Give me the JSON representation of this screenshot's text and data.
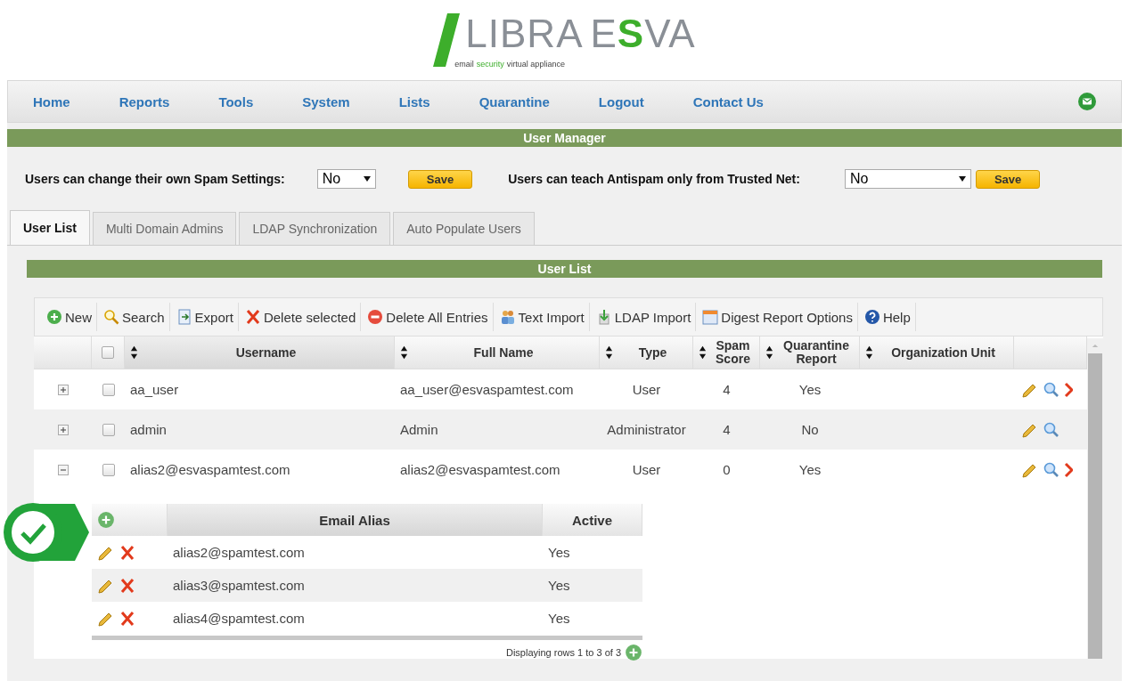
{
  "logo": {
    "words": [
      {
        "text": "LIBRA",
        "accent": false
      },
      {
        "text": "E",
        "accent": false
      },
      {
        "text": "S",
        "accent": true
      },
      {
        "text": "VA",
        "accent": false
      }
    ],
    "tagline": [
      {
        "text": "email",
        "accent": false
      },
      {
        "text": "security",
        "accent": true
      },
      {
        "text": "virtual appliance",
        "accent": false
      }
    ]
  },
  "nav": [
    "Home",
    "Reports",
    "Tools",
    "System",
    "Lists",
    "Quarantine",
    "Logout",
    "Contact Us"
  ],
  "section_title": "User Manager",
  "settings": [
    {
      "label": "Users can change their own Spam Settings:",
      "value": "No",
      "button": "Save",
      "wide": false
    },
    {
      "label": "Users can teach Antispam only from Trusted Net:",
      "value": "No",
      "button": "Save",
      "wide": true
    }
  ],
  "tabs": [
    {
      "label": "User List",
      "selected": true
    },
    {
      "label": "Multi Domain Admins",
      "selected": false
    },
    {
      "label": "LDAP Synchronization",
      "selected": false
    },
    {
      "label": "Auto Populate Users",
      "selected": false
    }
  ],
  "panel_title": "User List",
  "toolbar": [
    {
      "kind": "new",
      "label": "New"
    },
    {
      "kind": "search",
      "label": "Search"
    },
    {
      "kind": "export",
      "label": "Export"
    },
    {
      "kind": "delete",
      "label": "Delete selected"
    },
    {
      "kind": "delete-all",
      "label": "Delete All Entries"
    },
    {
      "kind": "import",
      "label": "Text Import"
    },
    {
      "kind": "ldap",
      "label": "LDAP Import"
    },
    {
      "kind": "digest",
      "label": "Digest Report Options"
    },
    {
      "kind": "help",
      "label": "Help"
    }
  ],
  "table": {
    "columns": [
      "Username",
      "Full Name",
      "Type",
      "Spam Score",
      "Quarantine Report",
      "Organization Unit"
    ],
    "header_checkbox": {
      "checked": false
    },
    "rows": [
      {
        "expanded": false,
        "checked": false,
        "username": "aa_user",
        "full_name": "aa_user@esvaspamtest.com",
        "type": "User",
        "spam_score": "4",
        "quarantine_report": "Yes",
        "deletable": true
      },
      {
        "expanded": false,
        "checked": false,
        "username": "admin",
        "full_name": "Admin",
        "type": "Administrator",
        "spam_score": "4",
        "quarantine_report": "No",
        "deletable": false
      },
      {
        "expanded": true,
        "checked": false,
        "username": "alias2@esvaspamtest.com",
        "full_name": "alias2@esvaspamtest.com",
        "type": "User",
        "spam_score": "0",
        "quarantine_report": "Yes",
        "deletable": true
      }
    ]
  },
  "alias_table": {
    "columns": [
      "Email Alias",
      "Active"
    ],
    "rows": [
      {
        "alias": "alias2@spamtest.com",
        "active": "Yes"
      },
      {
        "alias": "alias3@spamtest.com",
        "active": "Yes"
      },
      {
        "alias": "alias4@spamtest.com",
        "active": "Yes"
      }
    ],
    "footer": "Displaying rows 1 to 3 of 3"
  }
}
